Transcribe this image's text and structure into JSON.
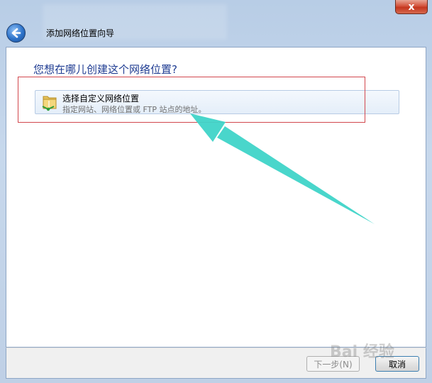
{
  "window": {
    "title": "添加网络位置向导",
    "close_glyph": "x"
  },
  "main": {
    "heading": "您想在哪儿创建这个网络位置?",
    "option": {
      "title": "选择自定义网络位置",
      "description": "指定网站、网络位置或 FTP 站点的地址。",
      "icon": "folder-network-icon"
    }
  },
  "footer": {
    "next_label": "下一步(N)",
    "cancel_label": "取消"
  },
  "watermark": "Bai 经验",
  "colors": {
    "heading": "#1f3c92",
    "highlight_box": "#d2474d",
    "annotation_arrow": "#3fd4c8"
  }
}
